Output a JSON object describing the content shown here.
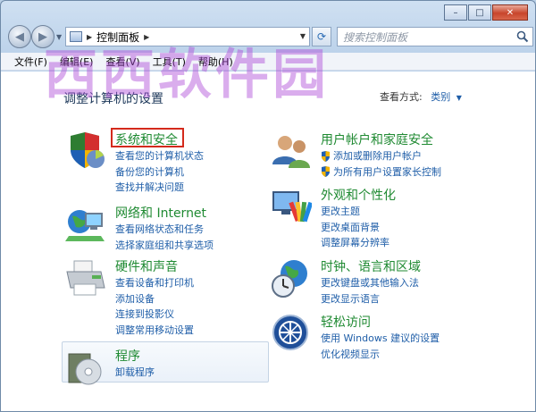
{
  "window": {
    "caption_buttons": {
      "minimize": "–",
      "maximize": "□",
      "close": "✕"
    }
  },
  "nav": {
    "back_icon": "arrow-left-icon",
    "forward_icon": "arrow-right-icon",
    "address_path": "控制面板",
    "search_placeholder": "搜索控制面板"
  },
  "menu": [
    "文件(F)",
    "编辑(E)",
    "查看(V)",
    "工具(T)",
    "帮助(H)"
  ],
  "main": {
    "title": "调整计算机的设置",
    "view_by_label": "查看方式:",
    "view_by_value": "类别"
  },
  "categories": {
    "system": {
      "title": "系统和安全",
      "links": [
        "查看您的计算机状态",
        "备份您的计算机",
        "查找并解决问题"
      ]
    },
    "network": {
      "title": "网络和 Internet",
      "links": [
        "查看网络状态和任务",
        "选择家庭组和共享选项"
      ]
    },
    "hardware": {
      "title": "硬件和声音",
      "links": [
        "查看设备和打印机",
        "添加设备",
        "连接到投影仪",
        "调整常用移动设置"
      ]
    },
    "programs": {
      "title": "程序",
      "links": [
        "卸载程序"
      ]
    },
    "users": {
      "title": "用户帐户和家庭安全",
      "links": [
        "添加或删除用户帐户",
        "为所有用户设置家长控制"
      ]
    },
    "appearance": {
      "title": "外观和个性化",
      "links": [
        "更改主题",
        "更改桌面背景",
        "调整屏幕分辨率"
      ]
    },
    "clock": {
      "title": "时钟、语言和区域",
      "links": [
        "更改键盘或其他输入法",
        "更改显示语言"
      ]
    },
    "access": {
      "title": "轻松访问",
      "links": [
        "使用 Windows 建议的设置",
        "优化视频显示"
      ]
    }
  },
  "watermark": "西西软件园",
  "colors": {
    "category_title": "#1f8a32",
    "link": "#1f5ea8",
    "highlight": "#d42a1c",
    "watermark": "#ac4ad6"
  }
}
